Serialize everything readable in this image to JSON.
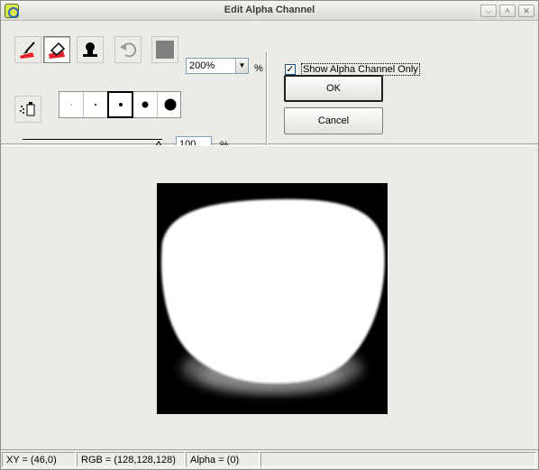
{
  "window": {
    "title": "Edit Alpha Channel"
  },
  "title_buttons": {
    "roll": "⌵",
    "maximize": "˄",
    "close": "✕"
  },
  "toolbar": {
    "tools": [
      {
        "name": "paint-brush-tool",
        "pressed": false
      },
      {
        "name": "eraser-tool",
        "pressed": true
      },
      {
        "name": "stamp-tool",
        "pressed": false
      },
      {
        "name": "undo-tool",
        "pressed": false
      },
      {
        "name": "color-swatch",
        "pressed": false
      }
    ],
    "zoom": {
      "value": "200%",
      "unit": "%"
    },
    "spray_tool": "spray-tool"
  },
  "brush_sizes": [
    {
      "size": 1,
      "selected": false
    },
    {
      "size": 2,
      "selected": false
    },
    {
      "size": 4,
      "selected": true
    },
    {
      "size": 7,
      "selected": false
    },
    {
      "size": 12,
      "selected": false
    }
  ],
  "opacity": {
    "value": "100",
    "unit": "%",
    "slider_level": 1.0
  },
  "options": {
    "show_alpha_only_label": "Show Alpha Channel Only",
    "show_alpha_only_checked": true
  },
  "buttons": {
    "ok": "OK",
    "cancel": "Cancel"
  },
  "status": {
    "xy": "XY = (46,0)",
    "rgb": "RGB = (128,128,128)",
    "alpha": "Alpha = (0)"
  },
  "colors": {
    "window_bg": "#ecebe6",
    "swatch": "#808080",
    "eraser_accent": "#e8202a"
  }
}
